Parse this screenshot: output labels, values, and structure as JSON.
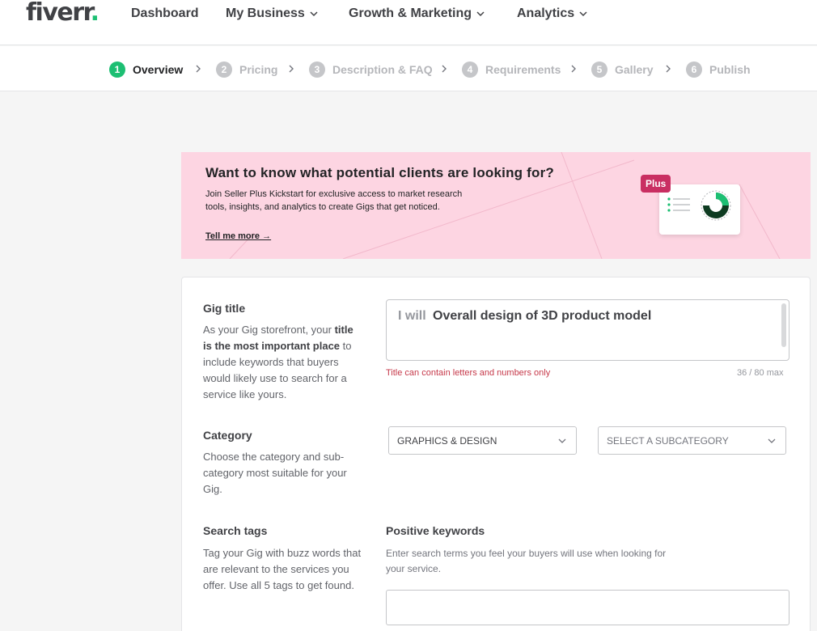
{
  "brand": {
    "logo_text": "fiverr",
    "logo_dot": ".",
    "accent": "#1dbf73"
  },
  "nav": {
    "items": [
      {
        "label": "Dashboard",
        "has_dropdown": false
      },
      {
        "label": "My Business",
        "has_dropdown": true
      },
      {
        "label": "Growth & Marketing",
        "has_dropdown": true
      },
      {
        "label": "Analytics",
        "has_dropdown": true
      }
    ]
  },
  "steps": [
    {
      "num": "1",
      "label": "Overview",
      "active": true
    },
    {
      "num": "2",
      "label": "Pricing",
      "active": false
    },
    {
      "num": "3",
      "label": "Description & FAQ",
      "active": false
    },
    {
      "num": "4",
      "label": "Requirements",
      "active": false
    },
    {
      "num": "5",
      "label": "Gallery",
      "active": false
    },
    {
      "num": "6",
      "label": "Publish",
      "active": false
    }
  ],
  "promo": {
    "heading": "Want to know what potential clients are looking for?",
    "body": "Join Seller Plus Kickstart for exclusive access to market research tools, insights, and analytics to create Gigs that get noticed.",
    "link": "Tell me more →",
    "badge": "Plus",
    "background": "#fdd5e2"
  },
  "gig_title": {
    "heading": "Gig title",
    "desc_pre": "As your Gig storefront, your ",
    "desc_bold": "title is the most important place",
    "desc_post": " to include keywords that buyers would likely use to search for a service like yours.",
    "prefix": "I will",
    "value": "Overall design of 3D product model",
    "error": "Title can contain letters and numbers only",
    "counter": "36 / 80 max"
  },
  "category": {
    "heading": "Category",
    "desc": "Choose the category and sub-category most suitable for your Gig.",
    "selected": "GRAPHICS & DESIGN",
    "sub_placeholder": "SELECT A SUBCATEGORY"
  },
  "search_tags": {
    "heading": "Search tags",
    "desc": "Tag your Gig with buzz words that are relevant to the services you offer. Use all 5 tags to get found.",
    "kw_heading": "Positive keywords",
    "kw_desc": "Enter search terms you feel your buyers will use when looking for your service.",
    "kw_value": ""
  }
}
